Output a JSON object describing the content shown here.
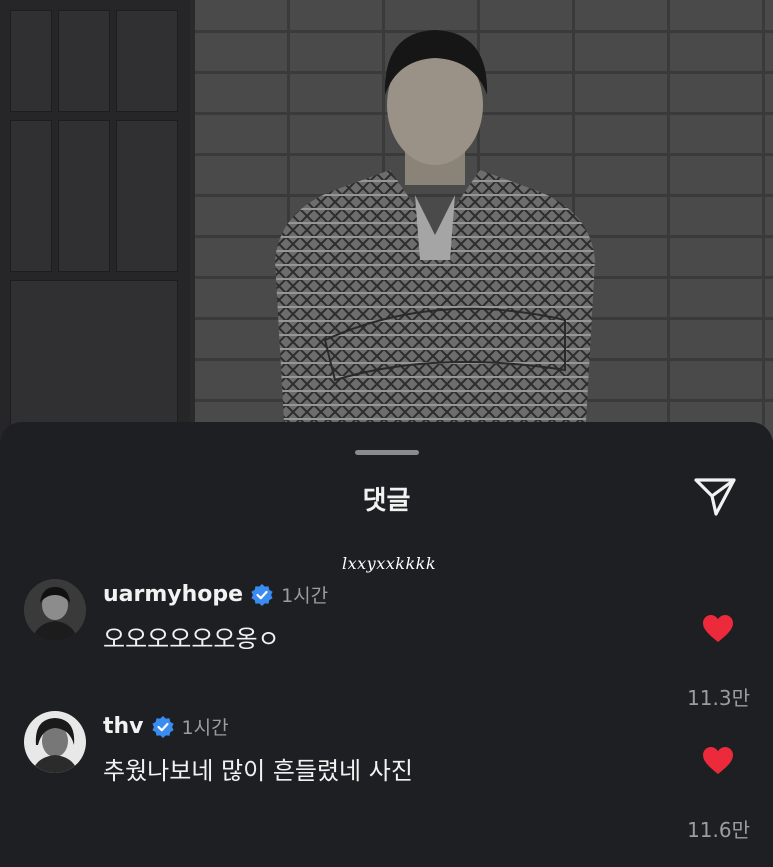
{
  "sheet": {
    "title": "댓글"
  },
  "watermark": "lxxyxxkkkk",
  "comments": [
    {
      "username": "uarmyhope",
      "time": "1시간",
      "text": "오오오오오오옹ㅇ",
      "likes": "11.3만"
    },
    {
      "username": "thv",
      "time": "1시간",
      "text": "추웠나보네 많이 흔들렸네 사진",
      "likes": "11.6만"
    }
  ],
  "colors": {
    "background": "#1e1f22",
    "verified": "#3b8cf0",
    "like": "#ed2a3b",
    "muted": "#9b9ca0"
  },
  "icons": {
    "share": "send-icon",
    "verified": "verified-badge-icon",
    "like": "heart-icon"
  }
}
